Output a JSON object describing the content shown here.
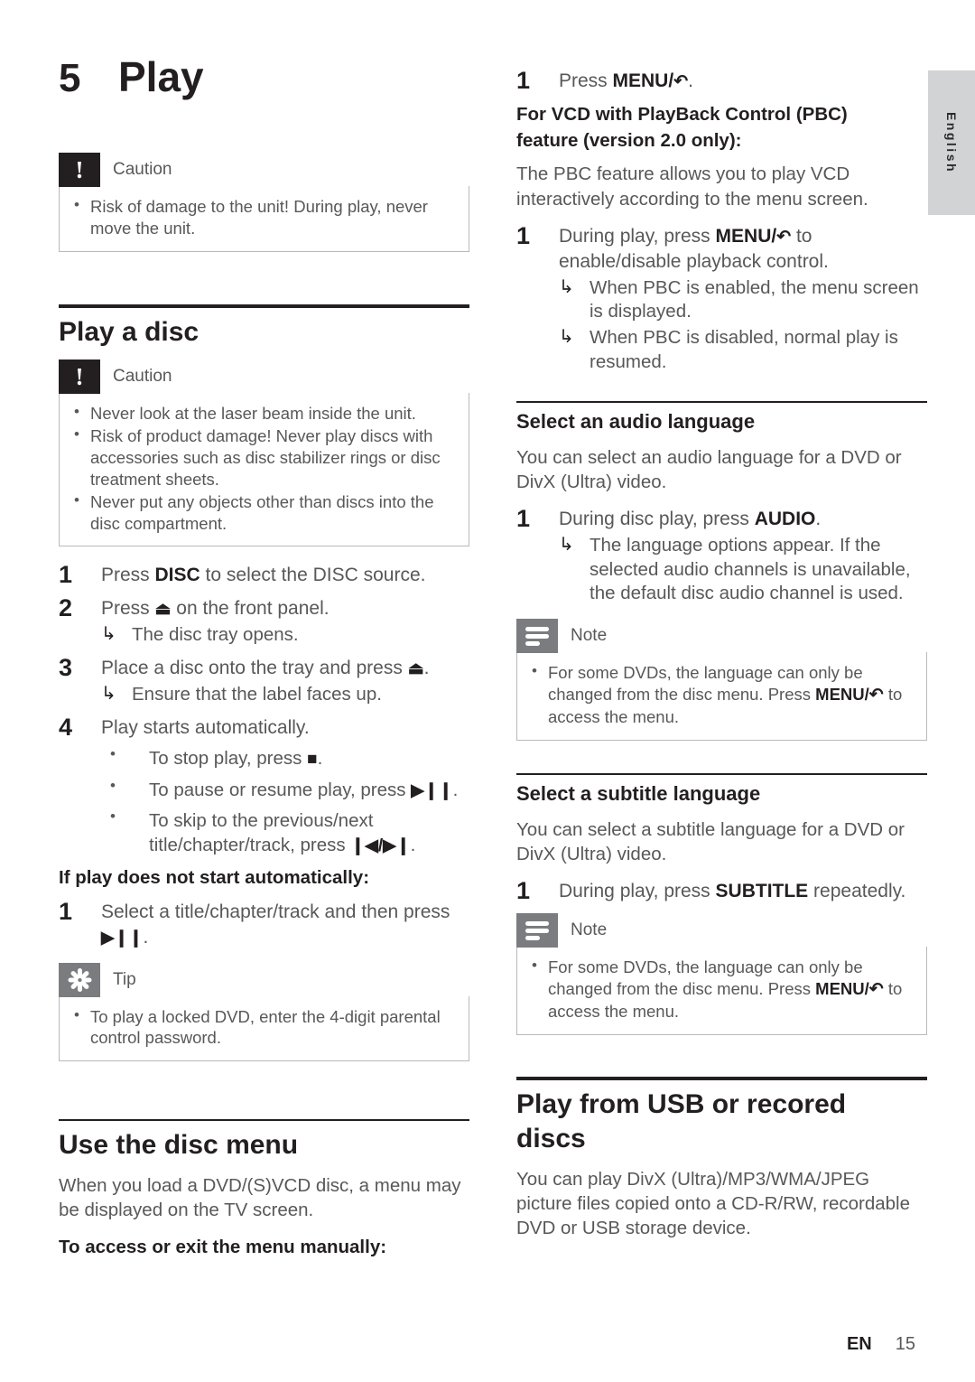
{
  "language_tab": {
    "label": "English"
  },
  "footer": {
    "locale": "EN",
    "page_number": "15"
  },
  "chapter": {
    "number": "5",
    "title": "Play"
  },
  "symbols": {
    "eject": "⏏",
    "stop": "■",
    "play_pause": "▶❙❙",
    "prev_next": "❙◀/▶❙",
    "menu_return": "↶",
    "result_arrow": "↳",
    "bullet": "•"
  },
  "left_column": {
    "caution_top": {
      "icon": "caution-icon",
      "title": "Caution",
      "items": [
        "Risk of damage to the unit! During play, never move the unit."
      ]
    },
    "section_play_a_disc": {
      "heading": "Play a disc",
      "caution": {
        "icon": "caution-icon",
        "title": "Caution",
        "items": [
          "Never look at the laser beam inside the unit.",
          "Risk of product damage! Never play discs with accessories such as disc stabilizer rings or disc treatment sheets.",
          "Never put any objects other than discs into the disc compartment."
        ]
      },
      "steps": [
        {
          "number": "1",
          "text_before": "Press ",
          "key": "DISC",
          "text_after": " to select the DISC source."
        },
        {
          "number": "2",
          "text_before": "Press ",
          "symbol": "eject",
          "text_after": " on the front panel.",
          "results": [
            "The disc tray opens."
          ]
        },
        {
          "number": "3",
          "text_before": "Place a disc onto the tray and press ",
          "symbol": "eject",
          "text_after": ".",
          "results": [
            "Ensure that the label faces up."
          ]
        },
        {
          "number": "4",
          "text_before": "Play starts automatically.",
          "options": [
            {
              "text_before": "To stop play, press ",
              "symbol": "stop",
              "text_after": "."
            },
            {
              "text_before": "To pause or resume play, press ",
              "symbol": "play_pause",
              "text_after": "."
            },
            {
              "text_before": "To skip to the previous/next title/chapter/track, press ",
              "symbol": "prev_next",
              "text_after": "."
            }
          ]
        }
      ],
      "fallback_lead": "If play does not start automatically:",
      "fallback_steps": [
        {
          "number": "1",
          "text_before": "Select a title/chapter/track and then press ",
          "symbol": "play_pause",
          "text_after": "."
        }
      ],
      "tip": {
        "icon": "tip-icon",
        "title": "Tip",
        "items": [
          "To play a locked DVD, enter the 4-digit parental control password."
        ]
      }
    },
    "section_use_the_disc_menu": {
      "heading": "Use the disc menu",
      "paragraph": "When you load a DVD/(S)VCD disc, a menu may be displayed on the TV screen.",
      "lead": "To access or exit the menu manually:"
    }
  },
  "right_column": {
    "menu_step": {
      "number": "1",
      "text_before": "Press ",
      "key": "MENU/",
      "symbol": "menu_return",
      "text_after": "."
    },
    "pbc": {
      "lead_line1": "For VCD with PlayBack Control (PBC)",
      "lead_line2": "feature (version 2.0 only):",
      "paragraph": "The PBC feature allows you to play VCD interactively according to the menu screen.",
      "steps": [
        {
          "number": "1",
          "text_before": "During play, press ",
          "key": "MENU/",
          "symbol": "menu_return",
          "text_after": " to enable/disable playback control.",
          "results": [
            "When PBC is enabled, the menu screen is displayed.",
            "When PBC is disabled, normal play is resumed."
          ]
        }
      ]
    },
    "section_audio_language": {
      "heading": "Select an audio language",
      "paragraph": "You can select an audio language for a DVD or DivX (Ultra) video.",
      "steps": [
        {
          "number": "1",
          "text_before": "During disc play, press ",
          "key": "AUDIO",
          "text_after": ".",
          "results": [
            "The language options appear. If the selected audio channels is unavailable, the default disc audio channel is used."
          ]
        }
      ],
      "note": {
        "icon": "note-icon",
        "title": "Note",
        "item_before": "For some DVDs, the language can only be changed from the disc menu. Press ",
        "item_key": "MENU/",
        "item_symbol": "menu_return",
        "item_after": " to access the menu."
      }
    },
    "section_subtitle_language": {
      "heading": "Select a subtitle language",
      "paragraph": "You can select a subtitle language for a DVD or DivX (Ultra) video.",
      "steps": [
        {
          "number": "1",
          "text_before": "During play, press ",
          "key": "SUBTITLE",
          "text_after": " repeatedly."
        }
      ],
      "note": {
        "icon": "note-icon",
        "title": "Note",
        "item_before": "For some DVDs, the language can only be changed from the disc menu. Press ",
        "item_key": "MENU/",
        "item_symbol": "menu_return",
        "item_after": " to access the menu."
      }
    },
    "section_play_from_usb": {
      "heading_line1": "Play from USB or recored",
      "heading_line2": "discs",
      "paragraph": "You can play DivX (Ultra)/MP3/WMA/JPEG picture files copied onto a CD-R/RW, recordable DVD or USB storage device."
    }
  }
}
